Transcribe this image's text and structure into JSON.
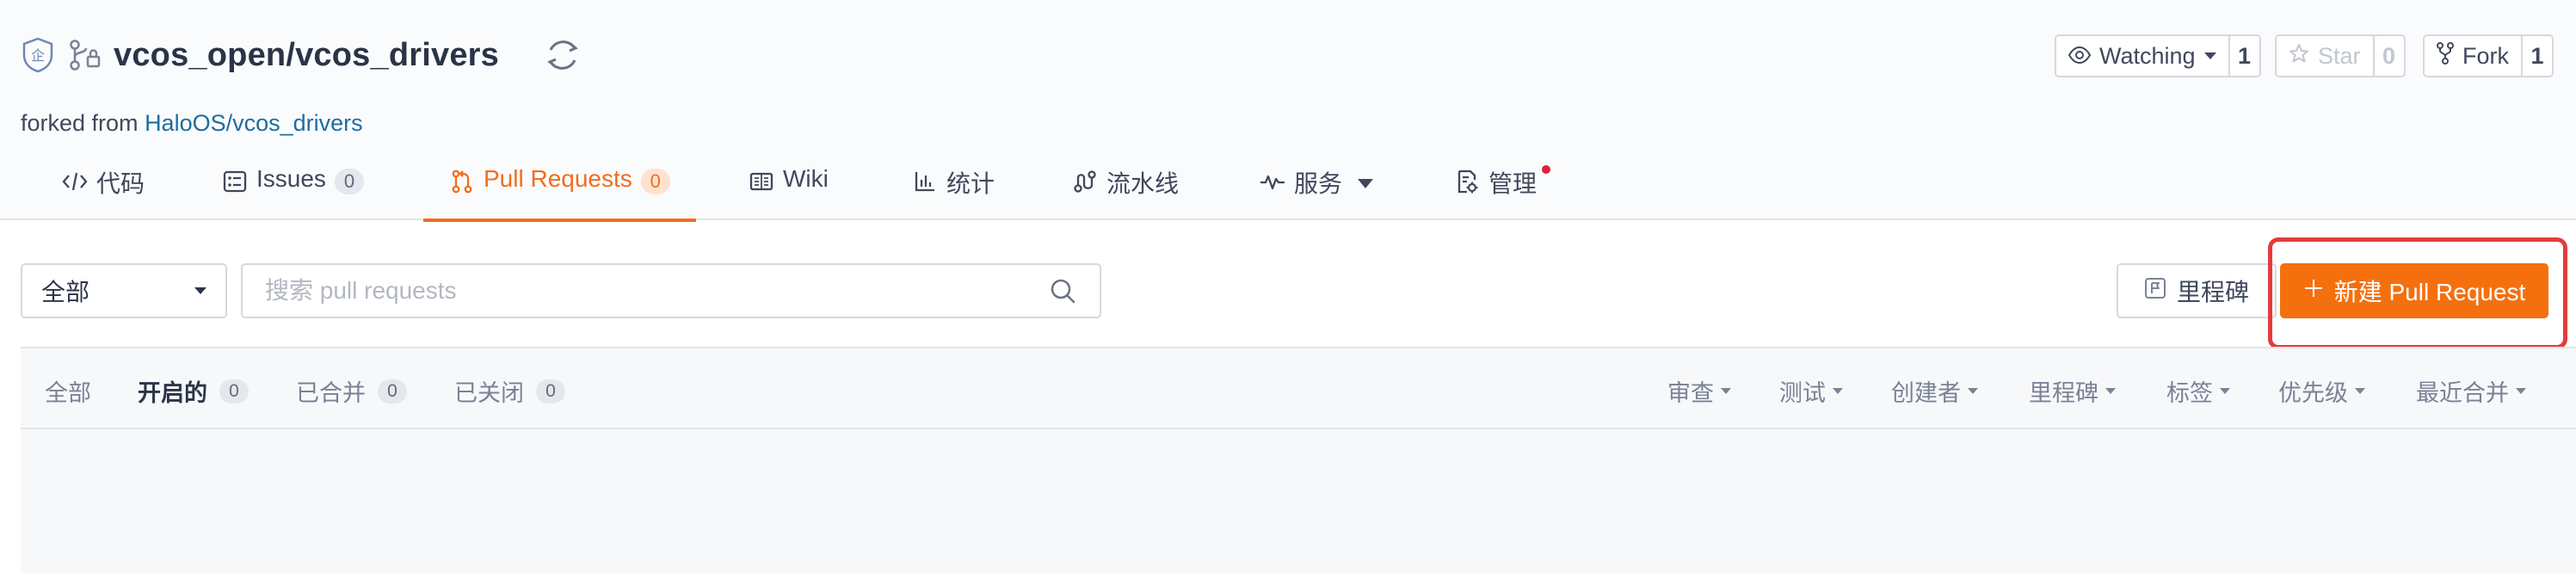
{
  "repo": {
    "owner_repo": "vcos_open/vcos_drivers",
    "forked_from_prefix": "forked from",
    "forked_from_link": "HaloOS/vcos_drivers"
  },
  "social": {
    "watch_label": "Watching",
    "watch_count": "1",
    "star_label": "Star",
    "star_count": "0",
    "fork_label": "Fork",
    "fork_count": "1"
  },
  "tabs": [
    {
      "label": "代码",
      "icon": "code-icon"
    },
    {
      "label": "Issues",
      "badge": "0",
      "icon": "issues-icon"
    },
    {
      "label": "Pull Requests",
      "badge": "0",
      "icon": "pull-request-icon",
      "active": true
    },
    {
      "label": "Wiki",
      "icon": "wiki-icon"
    },
    {
      "label": "统计",
      "icon": "bar-chart-icon"
    },
    {
      "label": "流水线",
      "icon": "pipeline-icon"
    },
    {
      "label": "服务",
      "icon": "pulse-icon"
    },
    {
      "label": "管理",
      "icon": "settings-doc-icon"
    }
  ],
  "toolbar": {
    "scope_select_value": "全部",
    "search_placeholder": "搜索 pull requests",
    "milestone_label": "里程碑",
    "new_pr_label": "新建 Pull Request"
  },
  "filters": {
    "states": [
      {
        "label": "全部"
      },
      {
        "label": "开启的",
        "badge": "0",
        "active": true
      },
      {
        "label": "已合并",
        "badge": "0"
      },
      {
        "label": "已关闭",
        "badge": "0"
      }
    ],
    "sorts": [
      "审查",
      "测试",
      "创建者",
      "里程碑",
      "标签",
      "优先级",
      "最近合并"
    ]
  },
  "colors": {
    "accent": "#f4700f",
    "link": "#1e6d9f",
    "highlight": "#e53b3b",
    "notification_dot": "#e3203a"
  }
}
